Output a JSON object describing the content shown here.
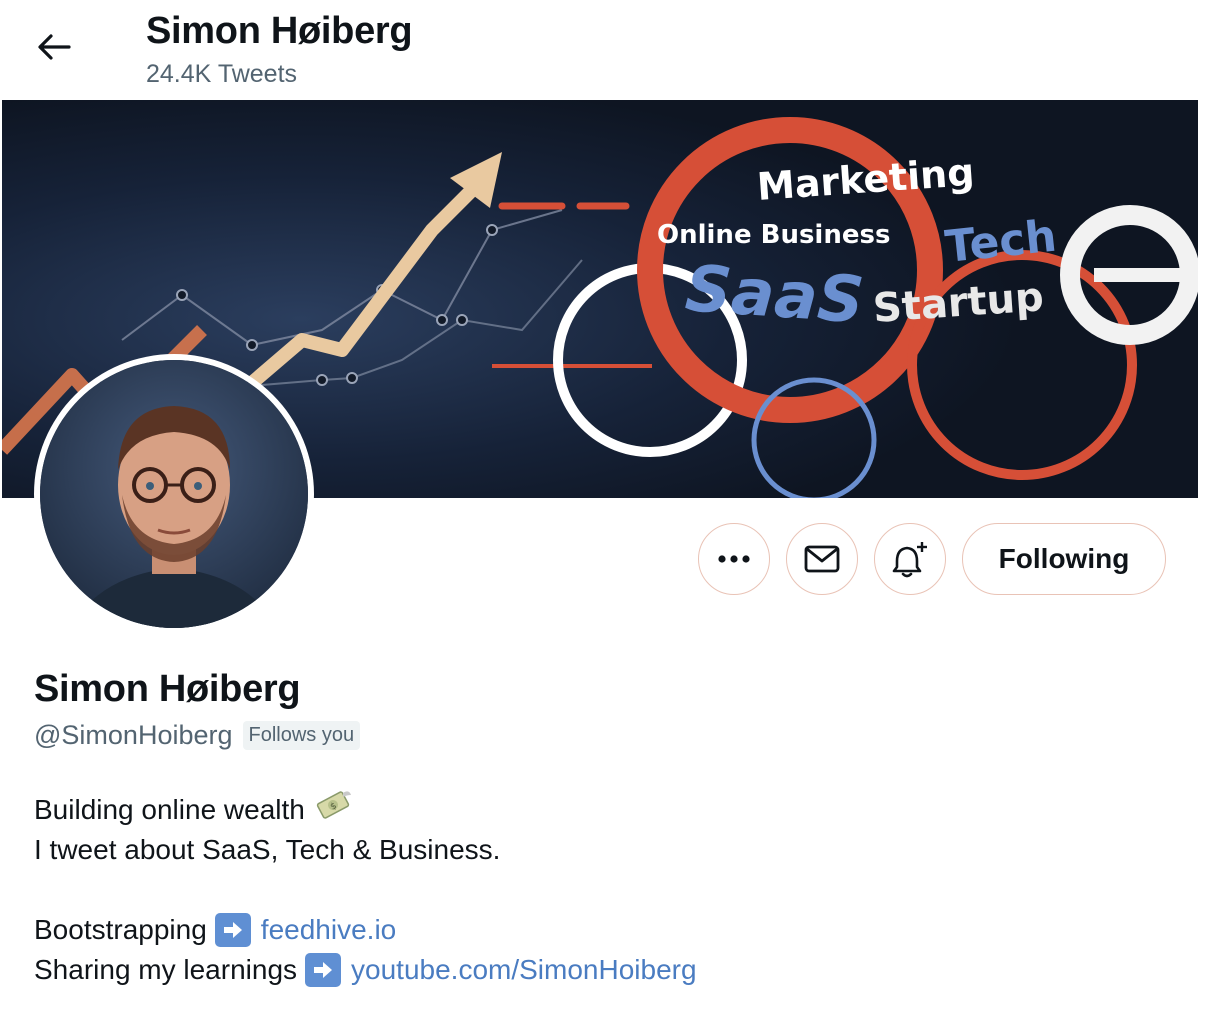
{
  "header": {
    "name": "Simon Høiberg",
    "tweet_count": "24.4K Tweets"
  },
  "banner": {
    "words": [
      "Marketing",
      "Online Business",
      "Tech",
      "SaaS",
      "Startup"
    ],
    "colors": {
      "background": "#121a28",
      "red": "#d64f37",
      "blue": "#6a8fd0",
      "arrow": "#e9c9a0"
    }
  },
  "actions": {
    "more_icon": "more-icon",
    "message_icon": "mail-icon",
    "notify_icon": "bell-plus-icon",
    "following_label": "Following"
  },
  "profile": {
    "name": "Simon Høiberg",
    "handle": "@SimonHoiberg",
    "follows_you": "Follows you"
  },
  "bio": {
    "line1": "Building online wealth",
    "line2": "I tweet about SaaS, Tech & Business.",
    "line3_text": "Bootstrapping",
    "line3_link": "feedhive.io",
    "line4_text": "Sharing my learnings",
    "line4_link": "youtube.com/SimonHoiberg"
  },
  "colors": {
    "link": "#4a7cc1",
    "secondary_text": "#536471",
    "button_border": "#e9c3b6"
  }
}
